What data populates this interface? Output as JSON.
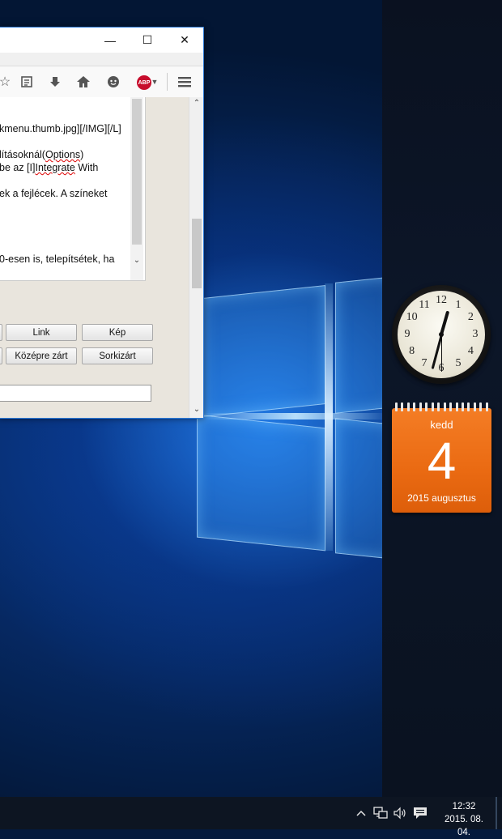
{
  "browser": {
    "window_controls": {
      "minimize": "—",
      "maximize": "☐",
      "close": "✕"
    },
    "toolbar_icons": [
      "star-icon",
      "reading-list-icon",
      "download-icon",
      "home-icon",
      "chat-icon",
      "adblock-icon",
      "menu-icon"
    ],
    "adblock_label": "ABP",
    "editor_lines": [
      "kmenu.thumb.jpg][/IMG][/L]",
      "lításoknál(",
      "Options",
      ")",
      "be az [I]",
      "Integrate",
      " With",
      "ek a fejlécek. A színeket",
      "0-esen is, telepítsétek, ha"
    ],
    "format_buttons_row1": [
      "Link",
      "Kép"
    ],
    "format_buttons_row2": [
      "Középre zárt",
      "Sorkizárt"
    ]
  },
  "gadgets": {
    "clock": {
      "numbers": [
        "12",
        "1",
        "2",
        "3",
        "4",
        "5",
        "6",
        "7",
        "8",
        "9",
        "10",
        "11"
      ],
      "hour": 12,
      "minute": 32,
      "second": 30
    },
    "calendar": {
      "weekday": "kedd",
      "day": "4",
      "month_year": "2015 augusztus"
    }
  },
  "taskbar": {
    "tray_icons": [
      "chevron-up-icon",
      "network-icon",
      "volume-icon",
      "action-center-icon"
    ],
    "time": "12:32",
    "date": "2015. 08. 04."
  }
}
